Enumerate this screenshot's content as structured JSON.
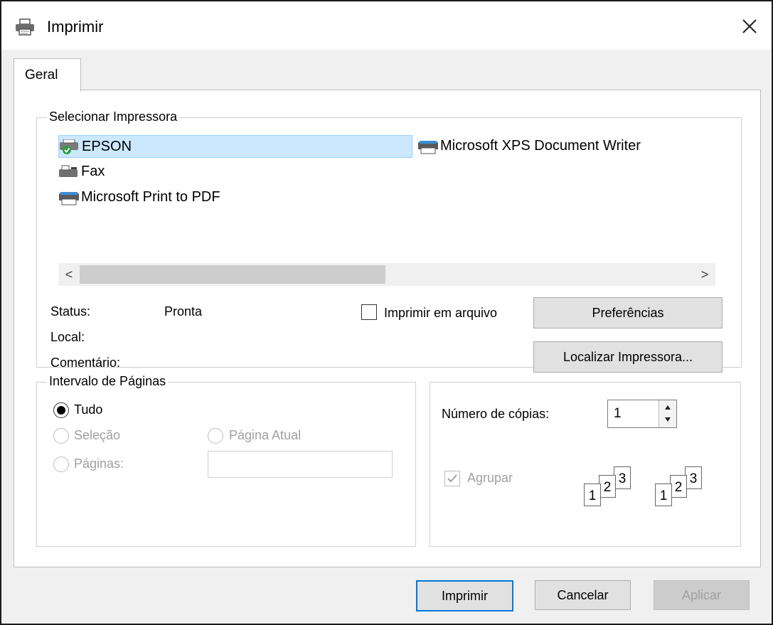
{
  "window": {
    "title": "Imprimir",
    "icon": "printer-icon",
    "close": "✕"
  },
  "tabs": [
    {
      "label": "Geral"
    }
  ],
  "select_printer": {
    "title": "Selecionar Impressora",
    "printers": [
      {
        "name": "EPSON",
        "icon": "default-printer-icon",
        "selected": true
      },
      {
        "name": "Fax",
        "icon": "fax-icon"
      },
      {
        "name": "Microsoft Print to PDF",
        "icon": "printer-icon"
      },
      {
        "name": "Microsoft XPS Document Writer",
        "icon": "printer-icon"
      }
    ],
    "status_label": "Status:",
    "status_value": "Pronta",
    "local_label": "Local:",
    "local_value": "",
    "comment_label": "Comentário:",
    "comment_value": "",
    "print_to_file_label": "Imprimir em arquivo",
    "print_to_file_checked": false,
    "preferences_label": "Preferências",
    "find_printer_label": "Localizar Impressora..."
  },
  "page_range": {
    "title": "Intervalo de Páginas",
    "all_label": "Tudo",
    "selection_label": "Seleção",
    "current_page_label": "Página Atual",
    "pages_label": "Páginas:",
    "pages_value": "",
    "selected": "all"
  },
  "copies": {
    "label": "Número de cópias:",
    "value": "1",
    "collate_label": "Agrupar",
    "collate_checked": true,
    "collate_pages": [
      "1",
      "2",
      "3"
    ]
  },
  "footer": {
    "print_label": "Imprimir",
    "cancel_label": "Cancelar",
    "apply_label": "Aplicar"
  }
}
